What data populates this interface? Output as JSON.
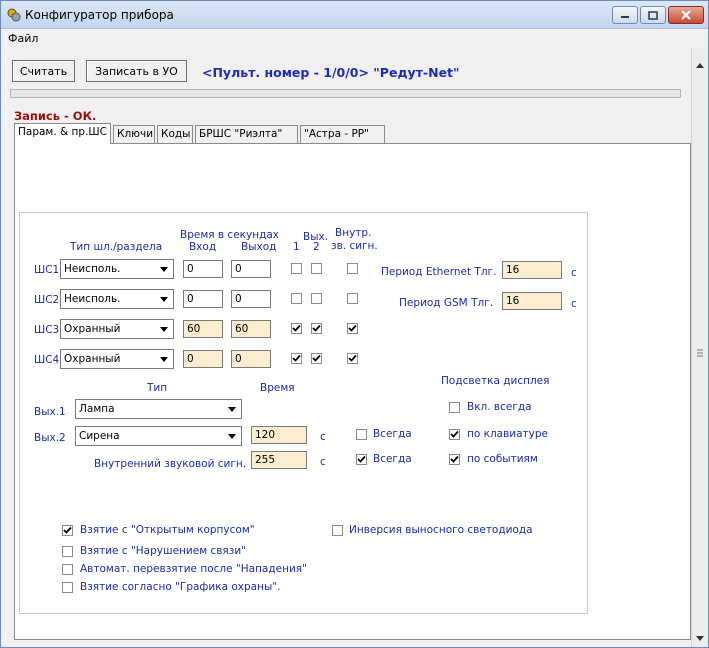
{
  "window": {
    "title": "Конфигуратор прибора"
  },
  "menu": {
    "file": "Файл"
  },
  "toolbar": {
    "read": "Считать",
    "write": "Записать в УО",
    "device": "<Пульт. номер - 1/0/0> \"Редут-Net\""
  },
  "status": "Запись - ОК.",
  "tabs": [
    "Парам. & пр.ШС",
    "Ключи",
    "Коды",
    "БРШС \"Риэлта\"",
    "\"Астра - РР\""
  ],
  "loops": {
    "header_type": "Тип шл./раздела",
    "header_time": "Время в секундах",
    "header_in": "Вход",
    "header_out": "Выход",
    "header_vyh": "Вых.",
    "header_1": "1",
    "header_2": "2",
    "header_internal": "Внутр.",
    "header_internal2": "зв. сигн.",
    "rows": [
      {
        "label": "ШС1",
        "type": "Неисполь.",
        "in": "0",
        "out": "0",
        "o1": false,
        "o2": false,
        "snd": false
      },
      {
        "label": "ШС2",
        "type": "Неисполь.",
        "in": "0",
        "out": "0",
        "o1": false,
        "o2": false,
        "snd": false
      },
      {
        "label": "ШС3",
        "type": "Охранный",
        "in": "60",
        "out": "60",
        "o1": true,
        "o2": true,
        "snd": true
      },
      {
        "label": "ШС4",
        "type": "Охранный",
        "in": "0",
        "out": "0",
        "o1": true,
        "o2": true,
        "snd": true
      }
    ]
  },
  "periods": {
    "eth_label": "Период Ethernet Тлг.",
    "eth_value": "16",
    "gsm_label": "Период GSM Тлг.",
    "gsm_value": "16",
    "unit": "с"
  },
  "outputs": {
    "header_type": "Тип",
    "header_time": "Время",
    "out1_label": "Вых.1",
    "out1_type": "Лампа",
    "out2_label": "Вых.2",
    "out2_type": "Сирена",
    "out2_time": "120",
    "out2_always": "Всегда",
    "internal_label": "Внутренний звуковой сигн.",
    "internal_time": "255",
    "internal_always": "Всегда",
    "unit": "с"
  },
  "backlight": {
    "title": "Подсветка дисплея",
    "always_on": "Вкл. всегда",
    "by_keyboard": "по клавиатуре",
    "by_events": "по событиям"
  },
  "options": {
    "open_case": "Взятие с \"Открытым корпусом\"",
    "invert_led": "Инверсия выносного светодиода",
    "link_fail": "Взятие с \"Нарушением связи\"",
    "auto_rearm": "Автомат. перевзятие после \"Нападения\"",
    "schedule": "Взятие согласно \"Графика охраны\"."
  }
}
